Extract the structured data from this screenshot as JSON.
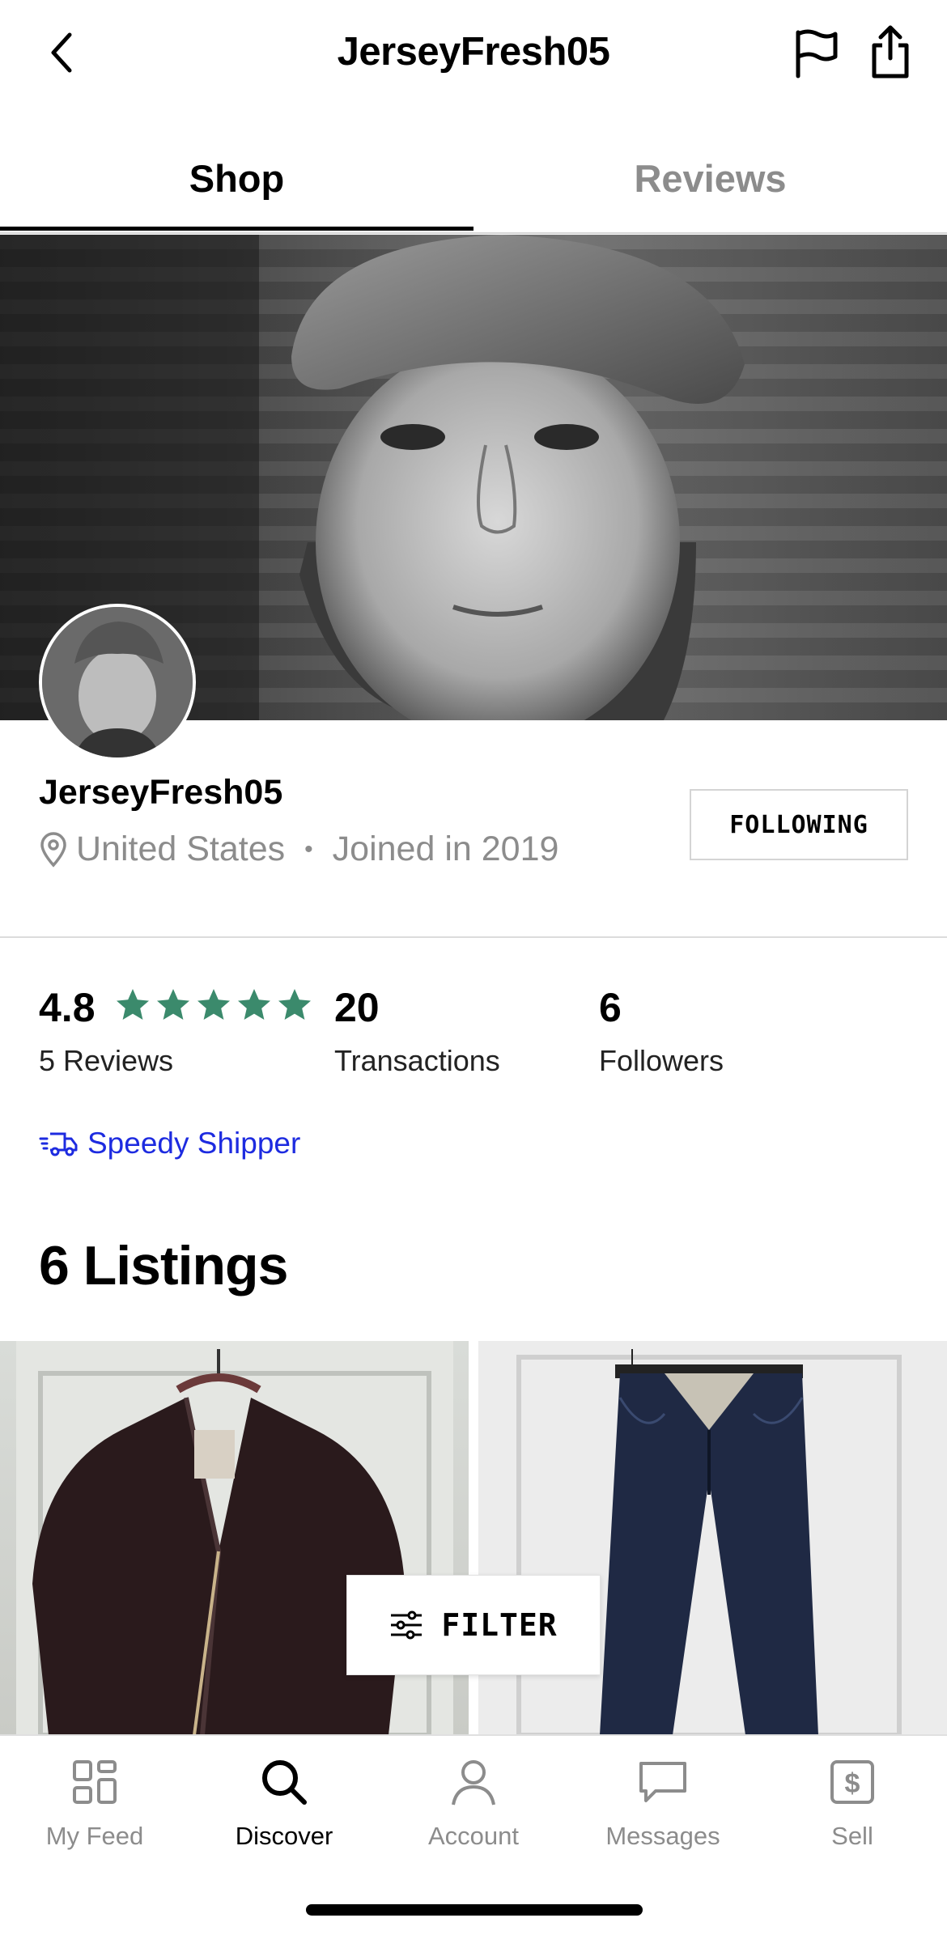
{
  "header": {
    "title": "JerseyFresh05",
    "back_icon": "chevron-left-icon",
    "flag_icon": "flag-icon",
    "share_icon": "share-icon"
  },
  "tabs": [
    {
      "label": "Shop",
      "active": true
    },
    {
      "label": "Reviews",
      "active": false
    }
  ],
  "profile": {
    "name": "JerseyFresh05",
    "location": "United States",
    "joined": "Joined in 2019",
    "follow_label": "FOLLOWING"
  },
  "stats": {
    "rating": "4.8",
    "stars": 5,
    "reviews_label": "5 Reviews",
    "transactions": "20",
    "transactions_label": "Transactions",
    "followers": "6",
    "followers_label": "Followers",
    "star_color": "#3b8a6c"
  },
  "badge": {
    "label": "Speedy Shipper",
    "color": "#1d2be0"
  },
  "listings": {
    "title": "6 Listings"
  },
  "filter": {
    "label": "FILTER"
  },
  "nav": [
    {
      "label": "My Feed",
      "icon": "grid-icon",
      "active": false
    },
    {
      "label": "Discover",
      "icon": "search-icon",
      "active": true
    },
    {
      "label": "Account",
      "icon": "person-icon",
      "active": false
    },
    {
      "label": "Messages",
      "icon": "chat-bubble-icon",
      "active": false
    },
    {
      "label": "Sell",
      "icon": "dollar-icon",
      "active": false
    }
  ]
}
